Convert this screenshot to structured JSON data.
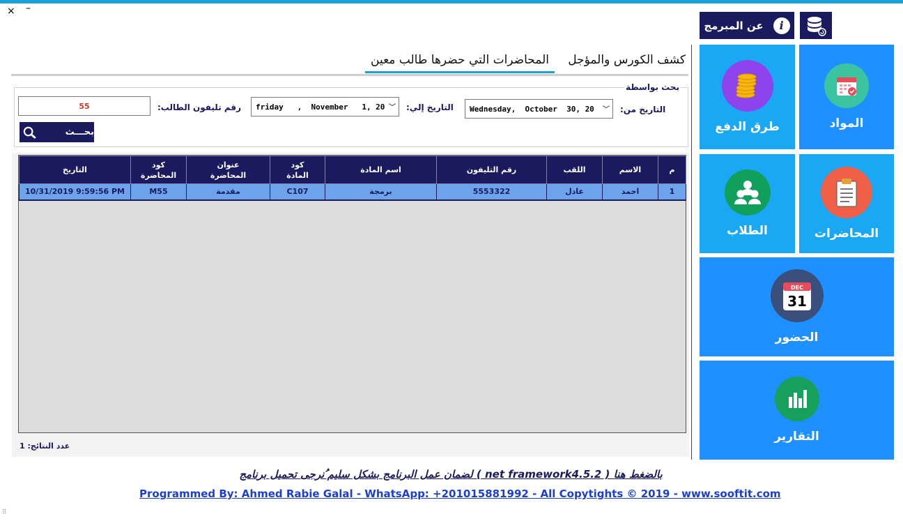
{
  "window": {
    "close": "×",
    "minimize": "–",
    "grip": "⠿"
  },
  "header": {
    "about_label": "عن المبرمج",
    "about_icon": "info-icon",
    "db_icon": "database-icon"
  },
  "tiles": {
    "materials": "المواد",
    "payments": "طرق الدفع",
    "lectures": "المحاضرات",
    "students": "الطلاب",
    "attendance": "الحضور",
    "reports": "التقارير",
    "calendar_month": "DEC",
    "calendar_day": "31"
  },
  "tabs": {
    "course": "كشف الكورس والمؤجل",
    "student": "المحاضرات التي حضرها طالب معين"
  },
  "search": {
    "group_title": "بحث بواسطة",
    "from_label": "التاريخ من:",
    "from_value": "Wednesday,  October  30, 20",
    "to_label": "التاريخ إلي:",
    "to_value": "friday   ,  November   1, 20",
    "phone_label": "رقم تليفون الطالب:",
    "phone_value": "55",
    "button_label": "بحـــث"
  },
  "table": {
    "headers": [
      "م",
      "الاسم",
      "اللقب",
      "رقم التليفون",
      "اسم المادة",
      "كود المادة",
      "عنوان المحاضرة",
      "كود المحاضرة",
      "التاريخ"
    ],
    "header_lines": [
      [
        "م"
      ],
      [
        "الاسم"
      ],
      [
        "اللقب"
      ],
      [
        "رقم التليفون"
      ],
      [
        "اسم المادة"
      ],
      [
        "كود",
        "المادة"
      ],
      [
        "عنوان",
        "المحاضرة"
      ],
      [
        "كود",
        "المحاضرة"
      ],
      [
        "التاريخ"
      ]
    ],
    "rows": [
      [
        "1",
        "احمد",
        "عادل",
        "5553322",
        "برمجة",
        "C107",
        "مقدمة",
        "M55",
        "10/31/2019 9:59:56 PM"
      ]
    ]
  },
  "results_count": "عدد النتائج: 1",
  "footer": {
    "framework_link": "لضمان عمل البرنامج بشكل سليم ُنرجى تحميل برنامج ( net framework4.5.2 ) بالضغط هنا",
    "credits": "Programmed By: Ahmed Rabie Galal - WhatsApp: +201015881992 - All Copytights © 2019 - www.sooftit.com"
  }
}
